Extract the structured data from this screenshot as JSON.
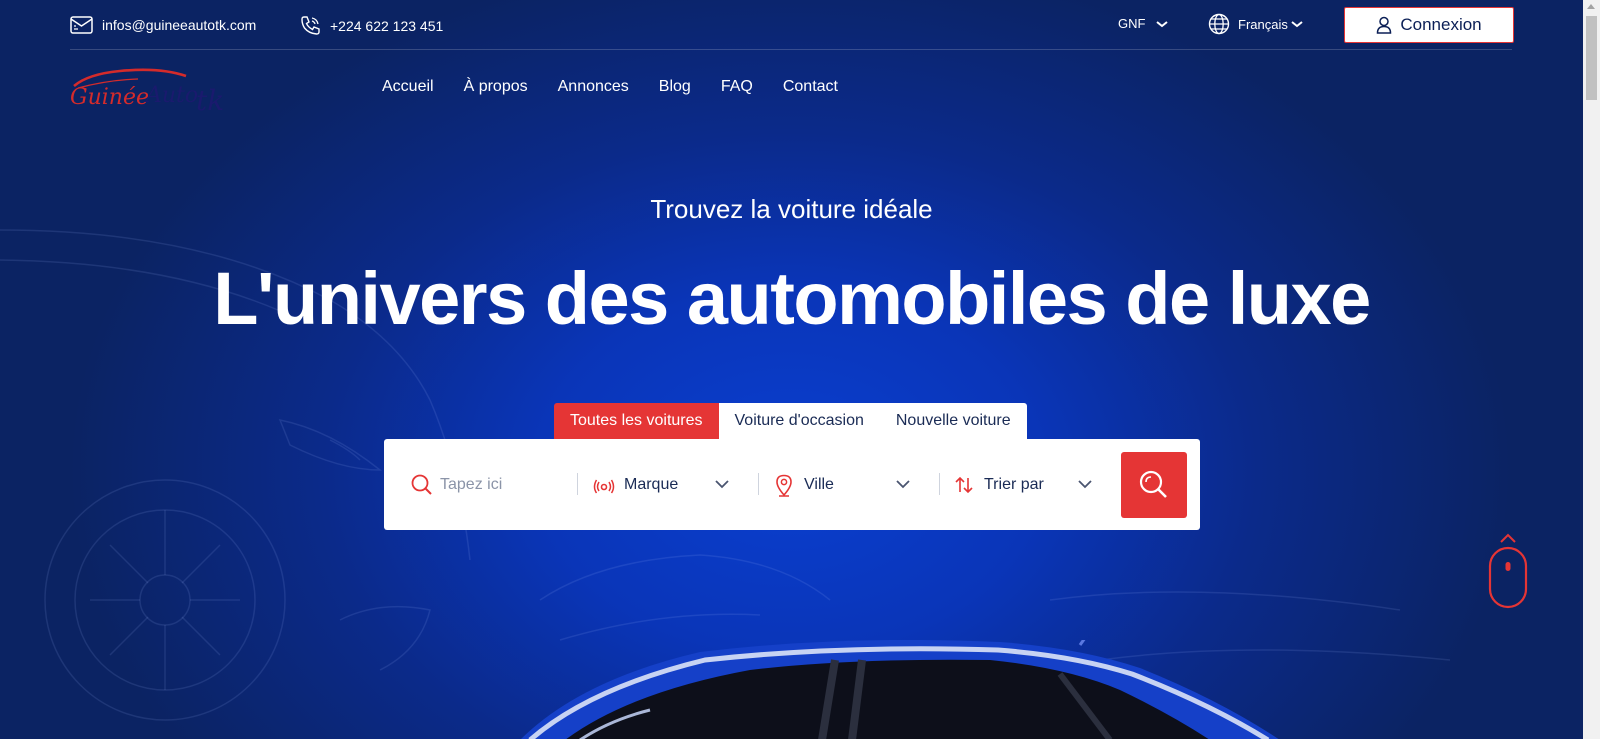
{
  "topbar": {
    "email": "infos@guineeautotk.com",
    "phone": "+224 622 123 451",
    "currency": "GNF",
    "language": "Français",
    "login_label": "Connexion"
  },
  "logo": {
    "text_part1": "Guinée",
    "text_part2": "Auto",
    "text_part3": "tk"
  },
  "nav": {
    "items": [
      "Accueil",
      "À propos",
      "Annonces",
      "Blog",
      "FAQ",
      "Contact"
    ]
  },
  "hero": {
    "subtitle": "Trouvez la voiture idéale",
    "headline": "L'univers des automobiles de luxe"
  },
  "tabs": {
    "items": [
      "Toutes les voitures",
      "Voiture d'occasion",
      "Nouvelle voiture"
    ],
    "active": "Toutes les voitures"
  },
  "search": {
    "placeholder": "Tapez ici",
    "brand_label": "Marque",
    "city_label": "Ville",
    "sort_label": "Trier par"
  },
  "colors": {
    "accent": "#e53535",
    "background_dark": "#0b2363",
    "background_bright": "#0a3fd0",
    "text_dark": "#1a2b55"
  },
  "icons": {
    "email": "email-icon",
    "phone": "phone-icon",
    "globe": "globe-icon",
    "user": "user-icon",
    "search": "search-icon",
    "brand": "signal-icon",
    "city": "location-pin-icon",
    "sort": "sort-arrows-icon",
    "scroll": "mouse-scroll-icon"
  }
}
